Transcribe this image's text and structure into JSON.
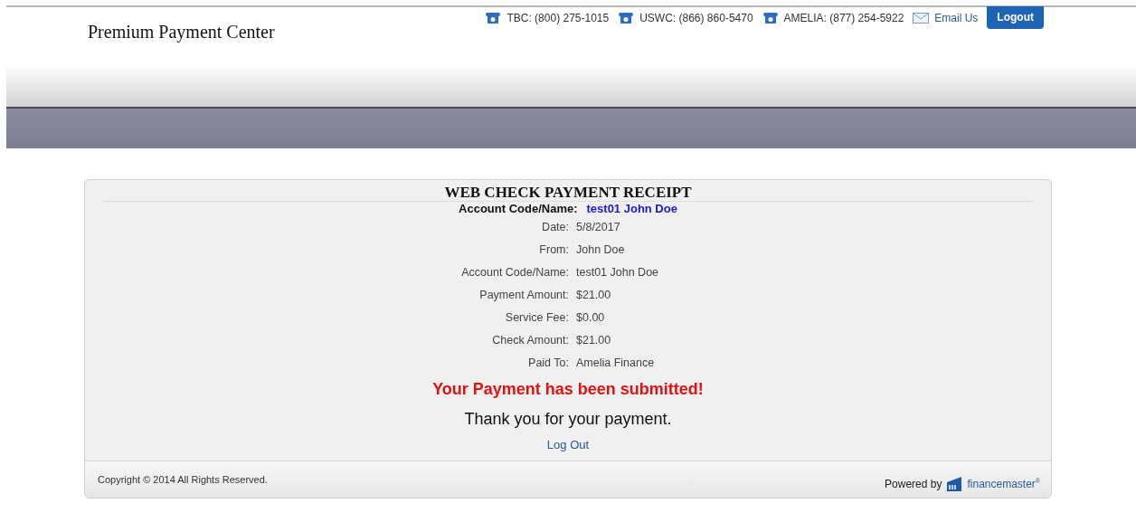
{
  "header": {
    "title": "Premium Payment Center",
    "contacts": [
      {
        "kind": "phone",
        "label": "TBC: (800) 275-1015"
      },
      {
        "kind": "phone",
        "label": "USWC: (866) 860-5470"
      },
      {
        "kind": "phone",
        "label": "AMELIA: (877) 254-5922"
      },
      {
        "kind": "email",
        "label": "Email Us"
      }
    ],
    "logout": "Logout"
  },
  "receipt": {
    "title": "WEB CHECK PAYMENT RECEIPT",
    "account_label": "Account Code/Name:",
    "account_value": "test01 John Doe",
    "rows": [
      {
        "label": "Date:",
        "value": "5/8/2017"
      },
      {
        "label": "From:",
        "value": "John Doe"
      },
      {
        "label": "Account Code/Name:",
        "value": "test01 John Doe"
      },
      {
        "label": "Payment Amount:",
        "value": "$21.00"
      },
      {
        "label": "Service Fee:",
        "value": "$0.00"
      },
      {
        "label": "Check Amount:",
        "value": "$21.00"
      },
      {
        "label": "Paid To:",
        "value": "Amelia Finance"
      }
    ],
    "status": "Your Payment has been submitted!",
    "thanks": "Thank you for your payment.",
    "logout_link": "Log Out"
  },
  "footer": {
    "copyright": "Copyright © 2014 All Rights Reserved.",
    "powered": "Powered by",
    "brand": "financemaster",
    "brand_mark": "®"
  }
}
